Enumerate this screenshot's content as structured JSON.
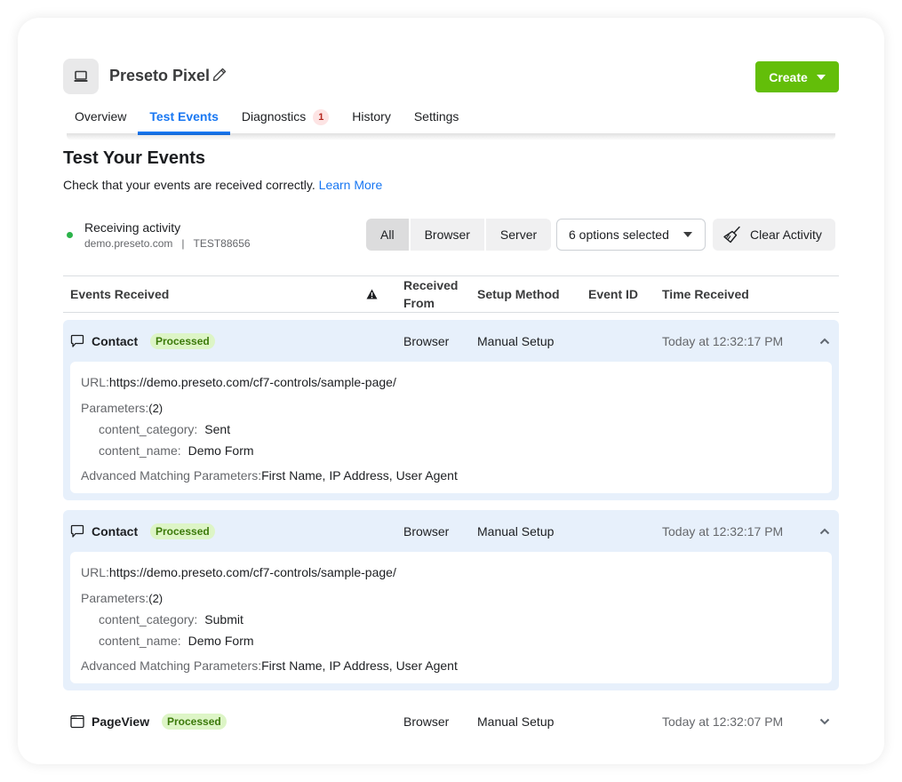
{
  "header": {
    "pixel_icon": "laptop-icon",
    "title": "Preseto Pixel",
    "edit_icon": "pencil-icon",
    "create_label": "Create"
  },
  "tabs": [
    {
      "label": "Overview",
      "active": false
    },
    {
      "label": "Test Events",
      "active": true
    },
    {
      "label": "Diagnostics",
      "active": false,
      "badge": "1"
    },
    {
      "label": "History",
      "active": false
    },
    {
      "label": "Settings",
      "active": false
    }
  ],
  "section": {
    "title": "Test Your Events",
    "description": "Check that your events are received correctly.",
    "learn_more": "Learn More"
  },
  "status": {
    "label": "Receiving activity",
    "domain": "demo.preseto.com",
    "separator": "|",
    "test_code": "TEST88656",
    "color": "#2bb34a"
  },
  "filters": {
    "segments": [
      "All",
      "Browser",
      "Server"
    ],
    "selected_segment": "All",
    "select_value": "6 options selected",
    "clear_label": "Clear Activity"
  },
  "table": {
    "columns": {
      "events": "Events Received",
      "warning_icon": "warning-icon",
      "received_from": "Received From",
      "setup_method": "Setup Method",
      "event_id": "Event ID",
      "time_received": "Time Received"
    },
    "events": [
      {
        "icon": "chat-bubble-icon",
        "name": "Contact",
        "status": "Processed",
        "received_from": "Browser",
        "setup_method": "Manual Setup",
        "event_id": "",
        "time": "Today at 12:32:17 PM",
        "expanded": true,
        "details": {
          "url_label": "URL:",
          "url": "https://demo.preseto.com/cf7-controls/sample-page/",
          "params_label": "Parameters:",
          "params_count": "(2)",
          "params": [
            {
              "key": "content_category:",
              "value": "Sent"
            },
            {
              "key": "content_name:",
              "value": "Demo Form"
            }
          ],
          "adv_label": "Advanced Matching Parameters:",
          "adv_value": "First Name, IP Address, User Agent"
        }
      },
      {
        "icon": "chat-bubble-icon",
        "name": "Contact",
        "status": "Processed",
        "received_from": "Browser",
        "setup_method": "Manual Setup",
        "event_id": "",
        "time": "Today at 12:32:17 PM",
        "expanded": true,
        "details": {
          "url_label": "URL:",
          "url": "https://demo.preseto.com/cf7-controls/sample-page/",
          "params_label": "Parameters:",
          "params_count": "(2)",
          "params": [
            {
              "key": "content_category:",
              "value": "Submit"
            },
            {
              "key": "content_name:",
              "value": "Demo Form"
            }
          ],
          "adv_label": "Advanced Matching Parameters:",
          "adv_value": "First Name, IP Address, User Agent"
        }
      },
      {
        "icon": "browser-window-icon",
        "name": "PageView",
        "status": "Processed",
        "received_from": "Browser",
        "setup_method": "Manual Setup",
        "event_id": "",
        "time": "Today at 12:32:07 PM",
        "expanded": false
      }
    ]
  }
}
